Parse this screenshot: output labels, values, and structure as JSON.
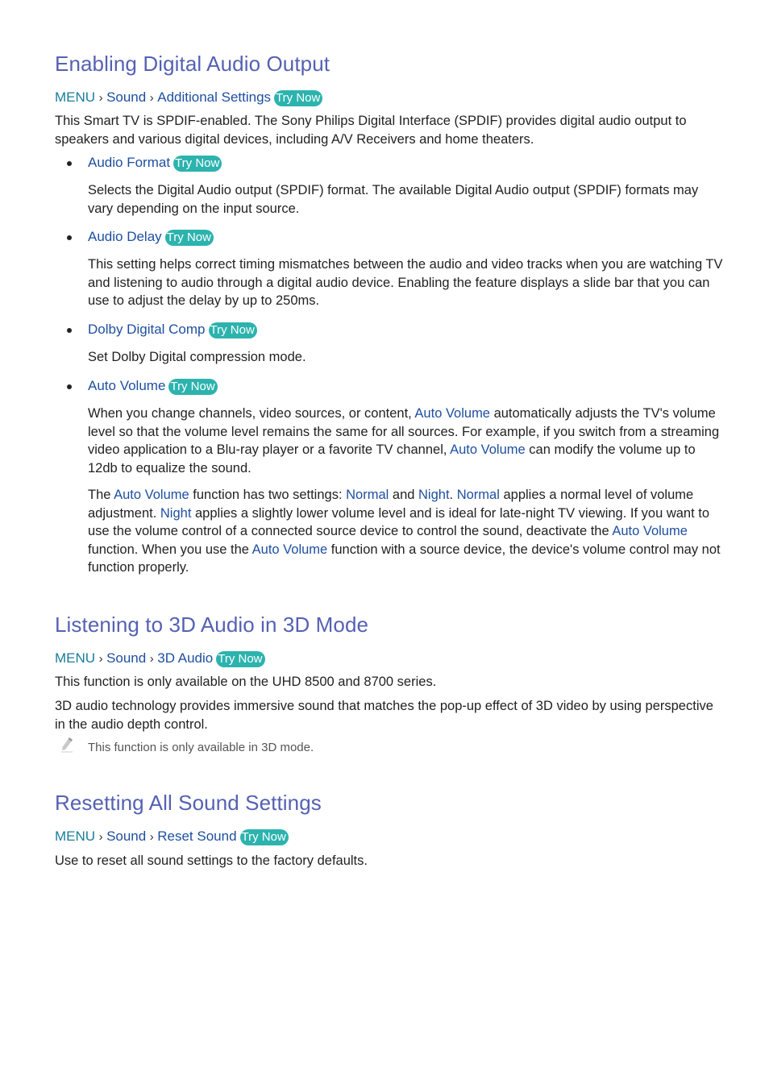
{
  "colors": {
    "heading": "#5561b3",
    "menu": "#1a7d9a",
    "link": "#1e4fa0",
    "try_now_bg": "#2cb3ae",
    "body_text": "#222222",
    "note_text": "#555555"
  },
  "sections": [
    {
      "title": "Enabling Digital Audio Output",
      "breadcrumb": {
        "menu": "MENU",
        "items": [
          "Sound",
          "Additional Settings"
        ],
        "try_now": "Try Now"
      },
      "intro": "This Smart TV is SPDIF-enabled. The Sony Philips Digital Interface (SPDIF) provides digital audio output to speakers and various digital devices, including A/V Receivers and home theaters.",
      "items": [
        {
          "label": "Audio Format",
          "try_now": "Try Now",
          "description": "Selects the Digital Audio output (SPDIF) format. The available Digital Audio output (SPDIF) formats may vary depending on the input source."
        },
        {
          "label": "Audio Delay",
          "try_now": "Try Now",
          "description": "This setting helps correct timing mismatches between the audio and video tracks when you are watching TV and listening to audio through a digital audio device. Enabling the feature displays a slide bar that you can use to adjust the delay by up to 250ms."
        },
        {
          "label": "Dolby Digital Comp",
          "try_now": "Try Now",
          "description": "Set Dolby Digital compression mode."
        },
        {
          "label": "Auto Volume",
          "try_now": "Try Now",
          "p1": {
            "t1": "When you change channels, video sources, or content, ",
            "h1": "Auto Volume",
            "t2": " automatically adjusts the TV's volume level so that the volume level remains the same for all sources. For example, if you switch from a streaming video application to a Blu-ray player or a favorite TV channel, ",
            "h2": "Auto Volume",
            "t3": " can modify the volume up to 12db to equalize the sound."
          },
          "p2": {
            "t1": "The ",
            "h1": "Auto Volume",
            "t2": " function has two settings: ",
            "h2": "Normal",
            "t3": " and ",
            "h3": "Night",
            "t4": ". ",
            "h4": "Normal",
            "t5": " applies a normal level of volume adjustment. ",
            "h5": "Night",
            "t6": " applies a slightly lower volume level and is ideal for late-night TV viewing. If you want to use the volume control of a connected source device to control the sound, deactivate the ",
            "h6": "Auto Volume",
            "t7": " function. When you use the ",
            "h7": "Auto Volume",
            "t8": " function with a source device, the device's volume control may not function properly."
          }
        }
      ]
    },
    {
      "title": "Listening to 3D Audio in 3D Mode",
      "breadcrumb": {
        "menu": "MENU",
        "items": [
          "Sound",
          "3D Audio"
        ],
        "try_now": "Try Now"
      },
      "paragraphs": [
        "This function is only available on the UHD 8500 and 8700 series.",
        "3D audio technology provides immersive sound that matches the pop-up effect of 3D video by using perspective in the audio depth control."
      ],
      "note": {
        "icon": "pencil-icon",
        "text": "This function is only available in 3D mode."
      }
    },
    {
      "title": "Resetting All Sound Settings",
      "breadcrumb": {
        "menu": "MENU",
        "items": [
          "Sound",
          "Reset Sound"
        ],
        "try_now": "Try Now"
      },
      "paragraphs": [
        "Use to reset all sound settings to the factory defaults."
      ]
    }
  ]
}
